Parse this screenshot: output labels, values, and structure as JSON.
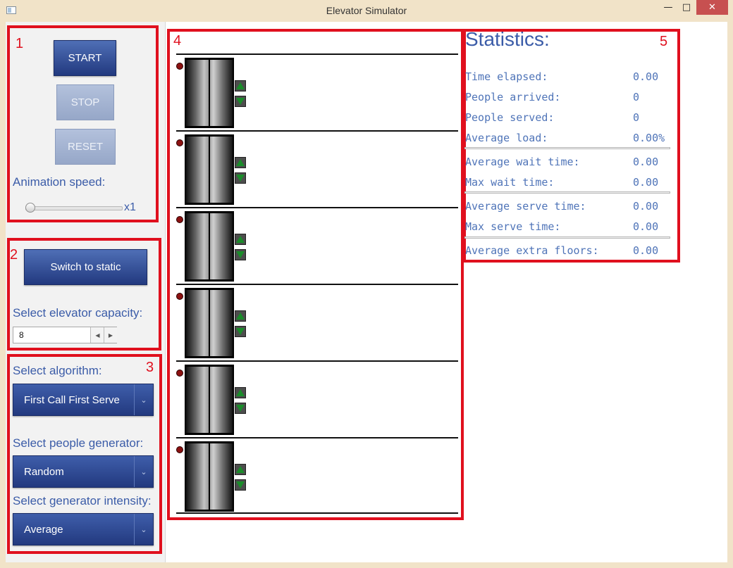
{
  "window": {
    "title": "Elevator Simulator",
    "minimize": "—",
    "maximize": "□",
    "close": "✕"
  },
  "sections": {
    "s1": "1",
    "s2": "2",
    "s3": "3",
    "s4": "4",
    "s5": "5"
  },
  "controls": {
    "start_label": "START",
    "stop_label": "STOP",
    "reset_label": "RESET",
    "speed_label": "Animation speed:",
    "speed_value": "x1",
    "speed_fraction": 0.0
  },
  "mode": {
    "switch_label": "Switch to static",
    "capacity_label": "Select elevator capacity:",
    "capacity_value": "8"
  },
  "settings": {
    "algorithm_label": "Select algorithm:",
    "algorithm_value": "First Call First Serve",
    "generator_label": "Select people generator:",
    "generator_value": "Random",
    "intensity_label": "Select generator intensity:",
    "intensity_value": "Average"
  },
  "elevators": {
    "floor_count": 6,
    "indicator_color": "#8c1212",
    "arrow_color": "#1a8c2a"
  },
  "statistics": {
    "title": "Statistics:",
    "rows": [
      {
        "label": "Time elapsed:",
        "value": "0.00"
      },
      {
        "label": "People arrived:",
        "value": "0"
      },
      {
        "label": "People served:",
        "value": "0"
      },
      {
        "label": "Average load:",
        "value": "0.00%"
      },
      {
        "label": "Average wait time:",
        "value": "0.00"
      },
      {
        "label": "Max wait time:",
        "value": "0.00"
      },
      {
        "label": "Average serve time:",
        "value": "0.00"
      },
      {
        "label": "Max serve time:",
        "value": "0.00"
      },
      {
        "label": "Average extra floors:",
        "value": "0.00"
      }
    ]
  },
  "colors": {
    "accent": "#22397f",
    "highlight_box": "#e0101e",
    "label_blue": "#3b5ca8"
  }
}
